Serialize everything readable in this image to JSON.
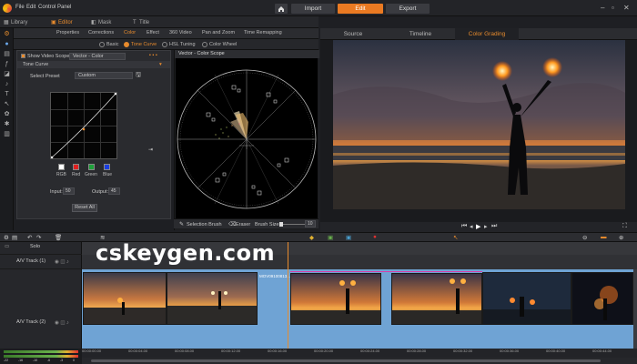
{
  "menu": {
    "file": "File",
    "edit": "Edit",
    "control_panel": "Control Panel"
  },
  "modes": {
    "home_icon": "home-icon",
    "import": "Import",
    "edit": "Edit",
    "export": "Export"
  },
  "top_tabs": [
    "Library",
    "Editor",
    "Mask",
    "Title"
  ],
  "sub_tabs": [
    "Properties",
    "Corrections",
    "Color",
    "Effect",
    "360 Video",
    "Pan and Zoom",
    "Time Remapping"
  ],
  "color_modes": [
    "Basic",
    "Tone Curve",
    "HSL Tuning",
    "Color Wheel"
  ],
  "tone": {
    "show_scope_label": "Show Video Scope",
    "scope_select": "Vector - Color",
    "section": "Tone Curve",
    "preset_label": "Select Preset",
    "preset_value": "Custom",
    "channels": [
      "RGB",
      "Red",
      "Green",
      "Blue"
    ],
    "input_label": "Input:",
    "input_value": "50",
    "output_label": "Output:",
    "output_value": "45",
    "reset": "Reset All"
  },
  "scope": {
    "title": "Vector - Color Scope"
  },
  "brush": {
    "selection": "Selection Brush",
    "eraser": "Eraser",
    "size_label": "Brush Size",
    "size_value": "10"
  },
  "preview_tabs": [
    "Source",
    "Timeline",
    "Color Grading"
  ],
  "tracks": [
    {
      "label": "Solo"
    },
    {
      "label": "A/V Track (1)"
    },
    {
      "label": "A/V Track (2)"
    }
  ],
  "clip_label": "MOV09100813...",
  "watermark": "cskeygen.com",
  "ruler": [
    "00:00:00.00",
    "00:00:04.00",
    "00:00:08.00",
    "00:00:12.00",
    "00:00:16.00",
    "00:00:20.00",
    "00:00:24.00",
    "00:00:28.00",
    "00:00:32.00",
    "00:00:36.00",
    "00:00:40.00",
    "00:00:44.00"
  ],
  "vu": [
    "-22",
    "-16",
    "-10",
    "-6",
    "-3",
    "0"
  ],
  "colors": {
    "accent": "#ea7a22",
    "clip_blue": "#6fa3d4",
    "clip_magenta": "#d43fa8"
  }
}
